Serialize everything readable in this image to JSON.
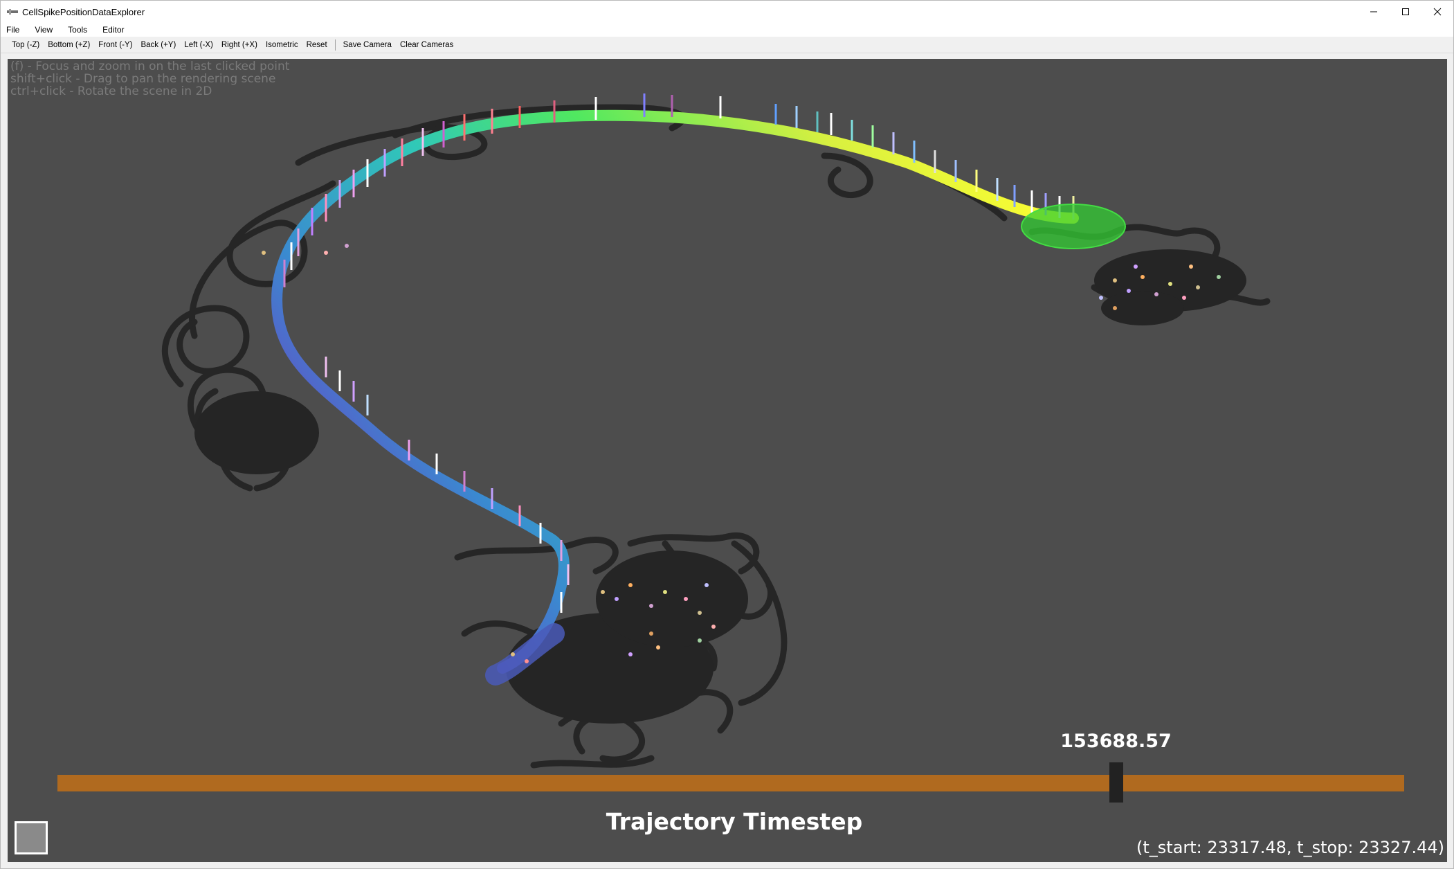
{
  "window": {
    "title": "CellSpikePositionDataExplorer"
  },
  "menu": [
    "File",
    "View",
    "Tools",
    "Editor"
  ],
  "toolbar": {
    "views": [
      "Top (-Z)",
      "Bottom (+Z)",
      "Front (-Y)",
      "Back (+Y)",
      "Left (-X)",
      "Right (+X)",
      "Isometric",
      "Reset"
    ],
    "camera": [
      "Save Camera",
      "Clear Cameras"
    ]
  },
  "help_text": [
    "(f) - Focus and zoom in on the last clicked point",
    "shift+click - Drag to pan the rendering scene",
    "ctrl+click - Rotate the scene in 2D"
  ],
  "slider": {
    "value_label": "153688.57",
    "title": "Trajectory Timestep",
    "position_fraction": 0.786
  },
  "time_range": "(t_start: 23317.48, t_stop: 23327.44)",
  "colors": {
    "background": "#4d4d4d",
    "slider_track": "#b06a1f",
    "trajectory_start": "#6060c0",
    "trajectory_mid": "#40e0a0",
    "trajectory_end": "#ffff40",
    "current_marker": "#33cc33"
  }
}
